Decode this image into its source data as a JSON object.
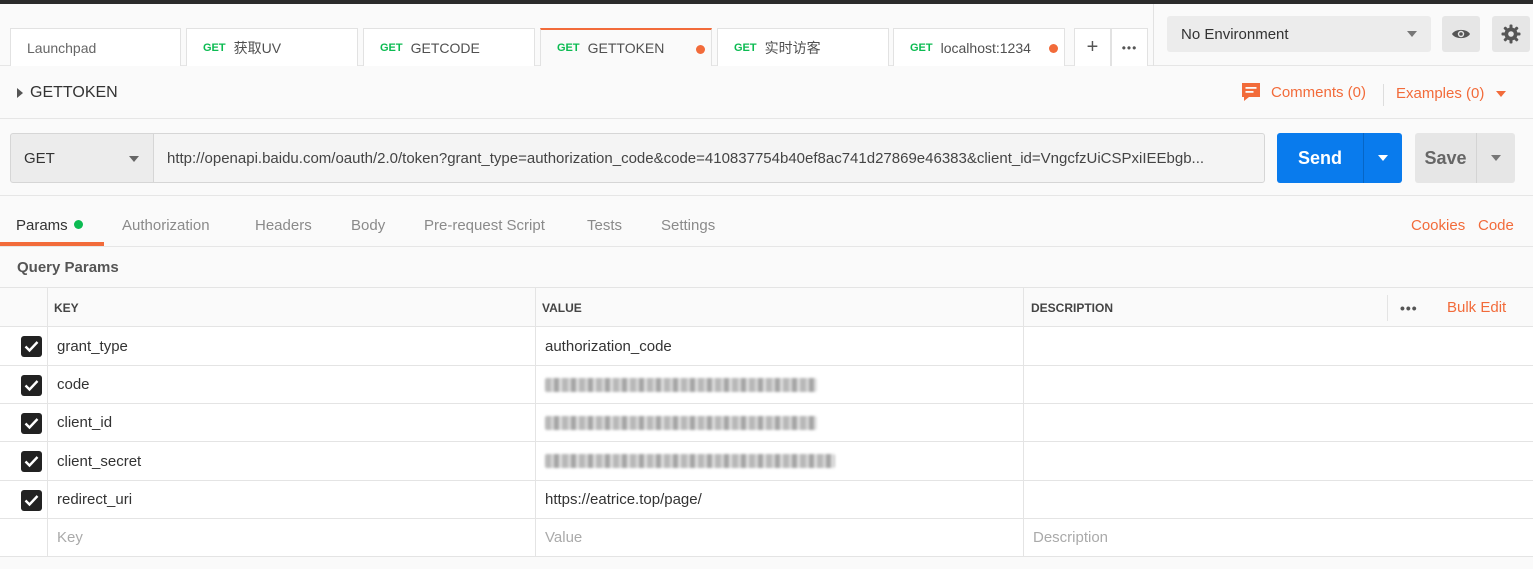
{
  "tabs": [
    {
      "method": "",
      "label": "Launchpad",
      "active": false,
      "dirty": false
    },
    {
      "method": "GET",
      "label": "获取UV",
      "active": false,
      "dirty": false
    },
    {
      "method": "GET",
      "label": "GETCODE",
      "active": false,
      "dirty": false
    },
    {
      "method": "GET",
      "label": "GETTOKEN",
      "active": true,
      "dirty": true
    },
    {
      "method": "GET",
      "label": "实时访客",
      "active": false,
      "dirty": false
    },
    {
      "method": "GET",
      "label": "localhost:1234",
      "active": false,
      "dirty": true
    }
  ],
  "tab_actions": {
    "new_tab": "+",
    "more": "•••"
  },
  "environment": {
    "selected": "No Environment"
  },
  "request": {
    "name": "GETTOKEN",
    "comments": "Comments (0)",
    "examples": "Examples (0)",
    "method": "GET",
    "url": "http://openapi.baidu.com/oauth/2.0/token?grant_type=authorization_code&code=410837754b40ef8ac741d27869e46383&client_id=VngcfzUiCSPxiIEEbgb...",
    "send_label": "Send",
    "save_label": "Save"
  },
  "subtabs": [
    "Params",
    "Authorization",
    "Headers",
    "Body",
    "Pre-request Script",
    "Tests",
    "Settings"
  ],
  "right_links": {
    "cookies": "Cookies",
    "code": "Code"
  },
  "query_params": {
    "title": "Query Params",
    "headers": {
      "key": "KEY",
      "value": "VALUE",
      "description": "DESCRIPTION",
      "bulk_edit": "Bulk Edit"
    },
    "rows": [
      {
        "checked": true,
        "key": "grant_type",
        "value": "authorization_code",
        "redacted": false
      },
      {
        "checked": true,
        "key": "code",
        "value": "",
        "redacted": true
      },
      {
        "checked": true,
        "key": "client_id",
        "value": "",
        "redacted": true
      },
      {
        "checked": true,
        "key": "client_secret",
        "value": "",
        "redacted": true
      },
      {
        "checked": true,
        "key": "redirect_uri",
        "value": "https://eatrice.top/page/",
        "redacted": false
      }
    ],
    "placeholders": {
      "key": "Key",
      "value": "Value",
      "description": "Description"
    }
  },
  "colors": {
    "accent": "#f26b3a",
    "send": "#097bed",
    "method_get": "#0cbb52"
  }
}
